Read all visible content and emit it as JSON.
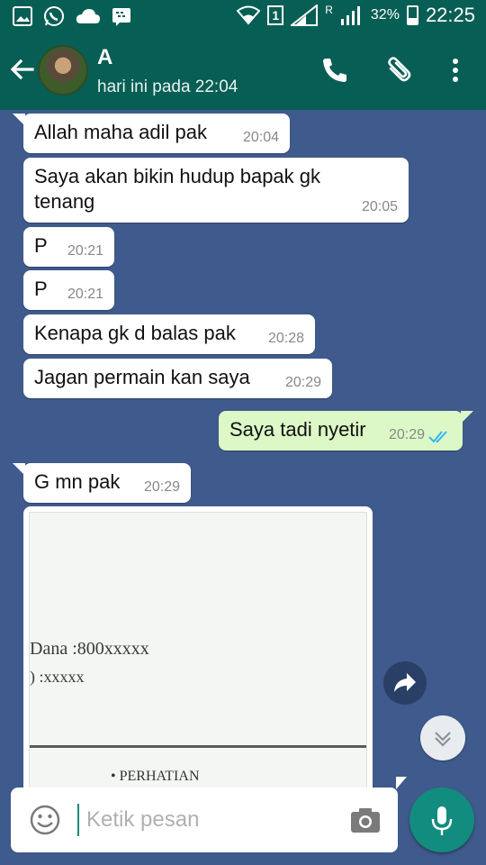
{
  "status_bar": {
    "icons": [
      "gallery-icon",
      "whatsapp-icon",
      "cloud-icon",
      "bbm-icon",
      "wifi-icon",
      "sim-icon",
      "signal-icon",
      "roaming-signal-icon",
      "battery-icon"
    ],
    "sim_label": "1",
    "roaming_label": "R",
    "battery": "32%",
    "time": "22:25"
  },
  "header": {
    "title": "A",
    "subtitle": "hari ini pada 22:04",
    "icons": [
      "back-arrow-icon",
      "avatar",
      "phone-icon",
      "attach-icon",
      "more-vert-icon"
    ]
  },
  "messages": [
    {
      "dir": "in",
      "text": "Allah maha adil pak",
      "time": "20:04"
    },
    {
      "dir": "in",
      "text": "Saya akan bikin hudup bapak gk tenang",
      "time": "20:05"
    },
    {
      "dir": "in",
      "text": "P",
      "time": "20:21"
    },
    {
      "dir": "in",
      "text": "P",
      "time": "20:21"
    },
    {
      "dir": "in",
      "text": "Kenapa gk d balas pak",
      "time": "20:28"
    },
    {
      "dir": "in",
      "text": "Jagan permain kan saya",
      "time": "20:29"
    },
    {
      "dir": "out",
      "text": "Saya tadi nyetir",
      "time": "20:29",
      "status": "read"
    },
    {
      "dir": "in",
      "text": "G mn pak",
      "time": "20:29"
    }
  ],
  "image_message": {
    "line1": "Dana :800xxxxx",
    "line2": ") :xxxxx",
    "line3": "• PERHATIAN"
  },
  "input": {
    "placeholder": "Ketik pesan",
    "icons": [
      "emoji-icon",
      "camera-icon",
      "mic-icon"
    ]
  },
  "colors": {
    "header": "#075e54",
    "background": "#3f5a8c",
    "outgoing": "#dcf8c6",
    "read_ticks": "#34b7f1",
    "mic_button": "#128c7e"
  }
}
